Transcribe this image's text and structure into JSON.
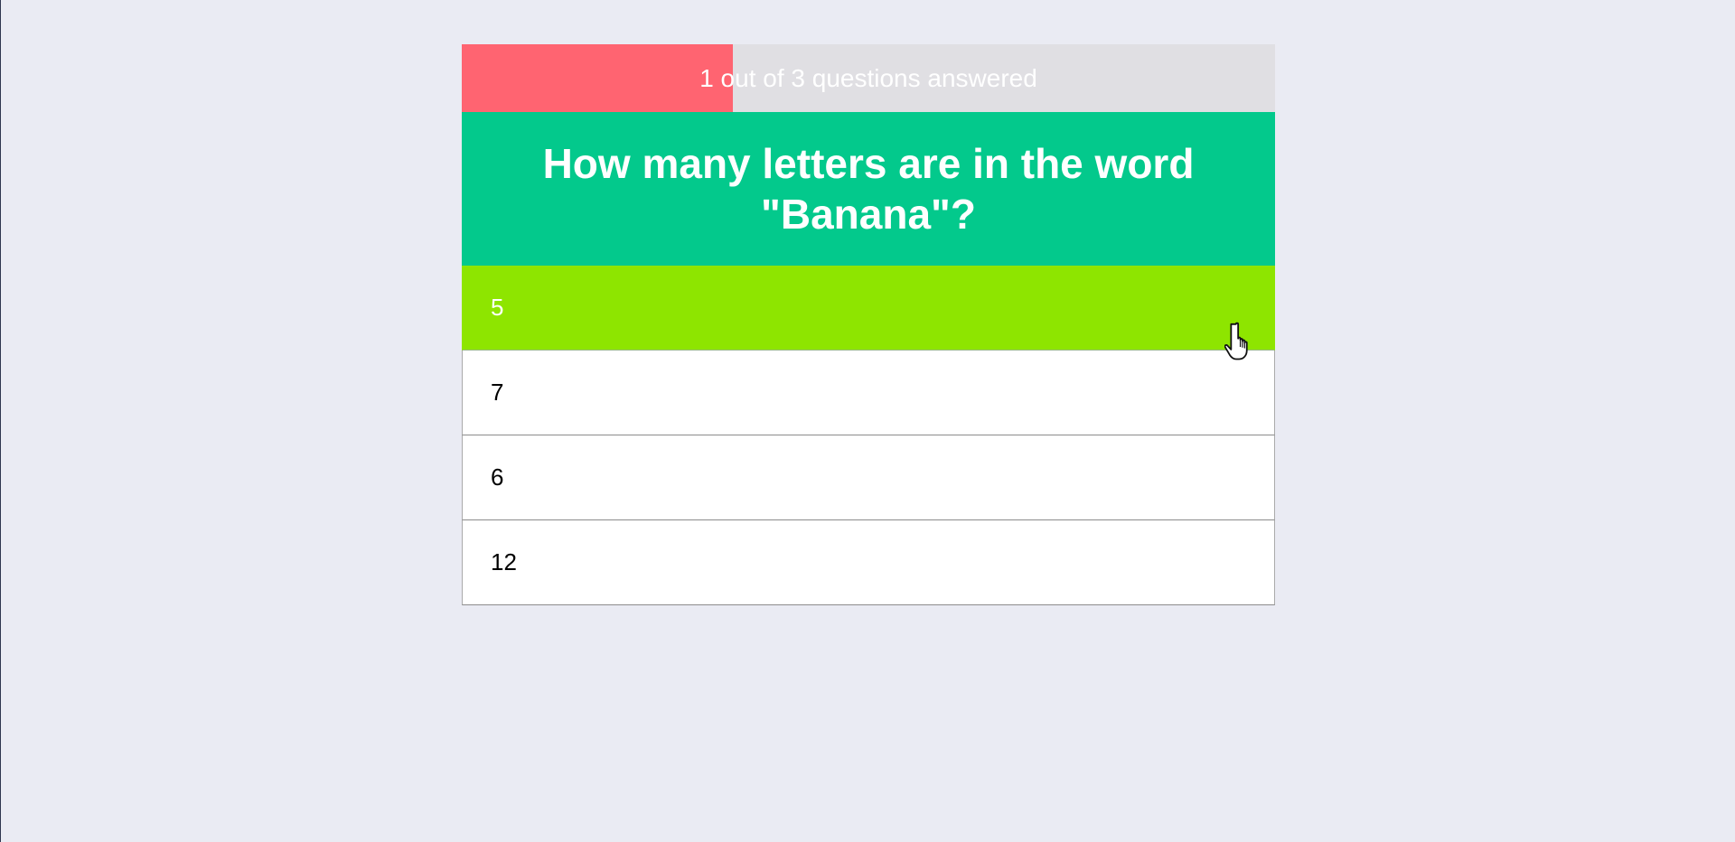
{
  "progress": {
    "text": "1 out of 3 questions answered",
    "answered": 1,
    "total": 3,
    "fill_color": "#ff6471",
    "track_color": "#e0dfe3"
  },
  "question": {
    "text": "How many letters are in the word \"Banana\"?",
    "background_color": "#03c98c"
  },
  "answers": [
    {
      "label": "5",
      "selected": true
    },
    {
      "label": "7",
      "selected": false
    },
    {
      "label": "6",
      "selected": false
    },
    {
      "label": "12",
      "selected": false
    }
  ],
  "colors": {
    "page_background": "#eaebf3",
    "selected_answer": "#8ee500",
    "answer_background": "#ffffff"
  },
  "cursor": {
    "icon": "hand-pointer-icon"
  }
}
